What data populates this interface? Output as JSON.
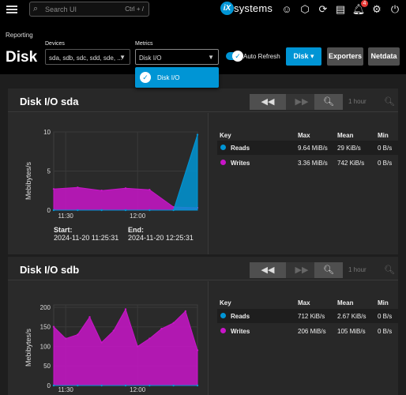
{
  "topbar": {
    "search_placeholder": "Search UI",
    "search_shortcut": "Ctrl + /",
    "logo_mark": "iX",
    "logo_text": "systems",
    "alerts_count": "4"
  },
  "page": {
    "breadcrumb": "Reporting",
    "title": "Disk",
    "devices_label": "Devices",
    "devices_value": "sda, sdb, sdc, sdd, sde, ...",
    "metrics_label": "Metrics",
    "metrics_value": "Disk I/O",
    "auto_refresh_label": "Auto Refresh",
    "disk_button": "Disk",
    "exporters_button": "Exporters",
    "netdata_button": "Netdata"
  },
  "metrics_dropdown": {
    "options": [
      "Disk I/O"
    ],
    "selected": "Disk I/O"
  },
  "colors": {
    "accent": "#0095d5",
    "reads": "#0095d5",
    "writes": "#c915c9",
    "background": "#1e1e1e"
  },
  "cards": [
    {
      "title": "Disk I/O sda",
      "range_label": "1 hour",
      "y_axis_label": "Mebibytes/s",
      "start_label": "Start:",
      "start_value": "2024-11-20 11:25:31",
      "end_label": "End:",
      "end_value": "2024-11-20 12:25:31",
      "legend_headers": [
        "Key",
        "Max",
        "Mean",
        "Min"
      ],
      "legend_rows": [
        {
          "key": "Reads",
          "max": "9.64 MiB/s",
          "mean": "29 KiB/s",
          "min": "0 B/s"
        },
        {
          "key": "Writes",
          "max": "3.36 MiB/s",
          "mean": "742 KiB/s",
          "min": "0 B/s"
        }
      ]
    },
    {
      "title": "Disk I/O sdb",
      "range_label": "1 hour",
      "y_axis_label": "Mebibytes/s",
      "legend_headers": [
        "Key",
        "Max",
        "Mean",
        "Min"
      ],
      "legend_rows": [
        {
          "key": "Reads",
          "max": "712 KiB/s",
          "mean": "2.67 KiB/s",
          "min": "0 B/s"
        },
        {
          "key": "Writes",
          "max": "206 MiB/s",
          "mean": "105 MiB/s",
          "min": "0 B/s"
        }
      ]
    }
  ],
  "chart_data": [
    {
      "type": "area",
      "y_axis_label": "Mebibytes/s",
      "ylim": [
        0,
        10
      ],
      "yticks": [
        "0",
        "5",
        "10"
      ],
      "xticks": [
        "11:30",
        "12:00"
      ],
      "series": [
        {
          "name": "Writes",
          "x": [
            "11:25",
            "11:35",
            "11:45",
            "11:55",
            "12:05",
            "12:15",
            "12:25"
          ],
          "values": [
            2.7,
            2.9,
            2.5,
            2.8,
            2.6,
            0.4,
            0.3
          ]
        },
        {
          "name": "Reads",
          "x": [
            "11:25",
            "11:35",
            "11:45",
            "11:55",
            "12:05",
            "12:15",
            "12:25"
          ],
          "values": [
            0,
            0,
            0,
            0,
            0,
            0,
            9.64
          ]
        }
      ]
    },
    {
      "type": "area",
      "y_axis_label": "Mebibytes/s",
      "ylim": [
        0,
        206
      ],
      "yticks": [
        "0",
        "50",
        "100",
        "150",
        "200"
      ],
      "xticks": [
        "11:30",
        "12:00"
      ],
      "series": [
        {
          "name": "Writes",
          "x": [
            "11:25",
            "11:30",
            "11:35",
            "11:40",
            "11:45",
            "11:50",
            "11:55",
            "12:00",
            "12:05",
            "12:10",
            "12:15",
            "12:20",
            "12:25"
          ],
          "values": [
            150,
            120,
            130,
            175,
            110,
            140,
            195,
            100,
            120,
            145,
            160,
            190,
            90
          ]
        },
        {
          "name": "Reads",
          "x": [
            "11:25",
            "11:35",
            "11:45",
            "11:55",
            "12:05",
            "12:15",
            "12:25"
          ],
          "values": [
            0,
            0,
            0,
            0,
            0,
            0,
            0
          ]
        }
      ]
    }
  ]
}
